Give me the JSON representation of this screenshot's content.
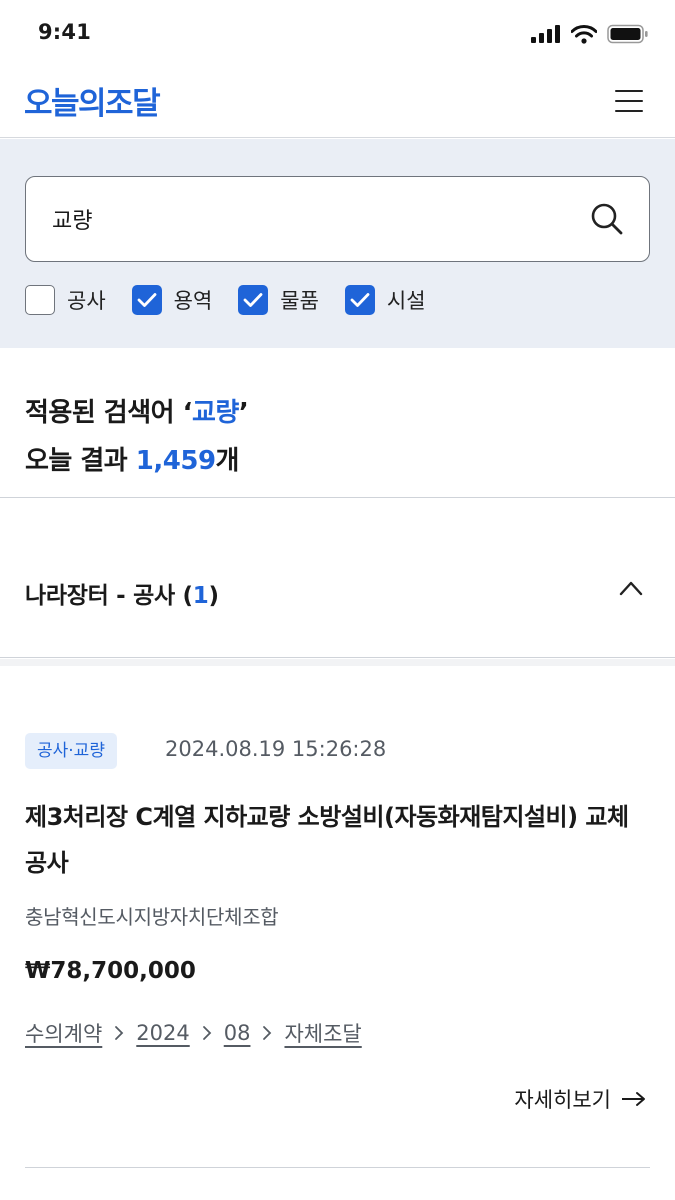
{
  "status_bar": {
    "time": "9:41"
  },
  "header": {
    "brand": "오늘의조달",
    "menu_icon": "hamburger-menu-icon"
  },
  "search": {
    "value": "교량",
    "placeholder": "",
    "icon": "search-icon"
  },
  "filters": [
    {
      "label": "공사",
      "checked": false
    },
    {
      "label": "용역",
      "checked": true
    },
    {
      "label": "물품",
      "checked": true
    },
    {
      "label": "시설",
      "checked": true
    }
  ],
  "summary": {
    "applied_prefix": "적용된 검색어 ",
    "open_quote": "‘",
    "keyword": "교량",
    "close_quote": "’",
    "today_prefix": "오늘 결과 ",
    "count": "1,459",
    "count_suffix": "개"
  },
  "section": {
    "title_prefix": "나라장터 - 공사 (",
    "count": "1",
    "title_suffix": ")",
    "expanded": true
  },
  "card": {
    "tag": "공사·교량",
    "date": "2024.08.19 15:26:28",
    "title": "제3처리장 C계열 지하교량 소방설비(자동화재탐지설비) 교체공사",
    "agency": "충남혁신도시지방자치단체조합",
    "price": "₩78,700,000",
    "breadcrumbs": [
      "수의계약",
      "2024",
      "08",
      "자체조달"
    ],
    "detail_label": "자세히보기"
  },
  "colors": {
    "accent": "#1f64d8",
    "search_bg": "#eaeef5",
    "tag_bg": "#e5eefb"
  }
}
